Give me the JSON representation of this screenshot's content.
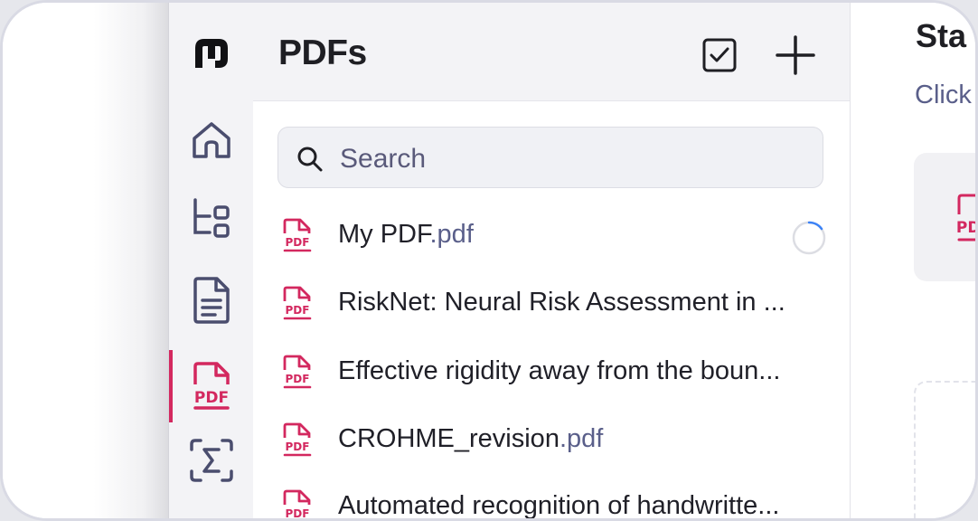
{
  "panel": {
    "title": "PDFs",
    "search_placeholder": "Search"
  },
  "rail": {
    "items": [
      {
        "icon": "app-logo-icon"
      },
      {
        "icon": "home-icon"
      },
      {
        "icon": "hierarchy-icon"
      },
      {
        "icon": "document-icon"
      },
      {
        "icon": "pdf-icon",
        "active": true
      },
      {
        "icon": "sigma-icon"
      }
    ]
  },
  "files": [
    {
      "name": "My PDF",
      "ext": ".pdf",
      "loading": true
    },
    {
      "name": "RiskNet: Neural Risk Assessment in ...",
      "ext": ""
    },
    {
      "name": "Effective rigidity away from the boun...",
      "ext": ""
    },
    {
      "name": "CROHME_revision",
      "ext": ".pdf"
    },
    {
      "name": "Automated recognition of handwritte...",
      "ext": ""
    }
  ],
  "right": {
    "heading": "Sta",
    "subtext": "Click"
  },
  "colors": {
    "accent": "#d3285f",
    "muted_text": "#5a5f8a",
    "icon": "#4a4d6e"
  }
}
